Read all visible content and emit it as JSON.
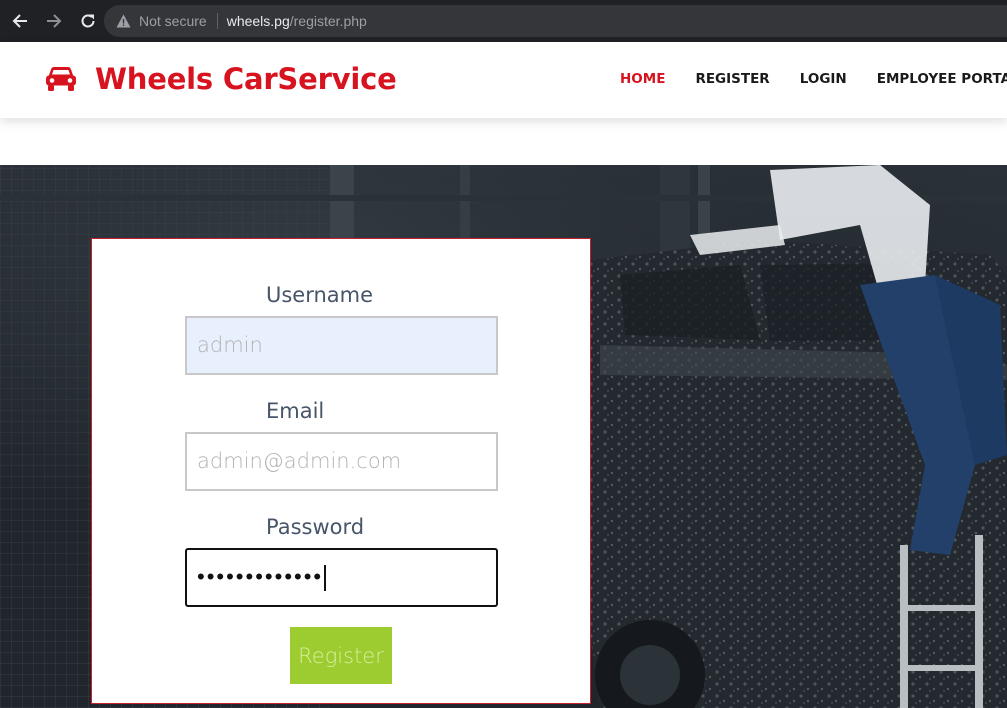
{
  "browser": {
    "security_label": "Not secure",
    "url_host": "wheels.pg",
    "url_path": "/register.php"
  },
  "header": {
    "brand": "Wheels CarService",
    "nav": [
      {
        "label": "HOME",
        "active": true
      },
      {
        "label": "REGISTER",
        "active": false
      },
      {
        "label": "LOGIN",
        "active": false
      },
      {
        "label": "EMPLOYEE PORTAL",
        "active": false
      }
    ]
  },
  "form": {
    "username_label": "Username",
    "username_value": "admin",
    "email_label": "Email",
    "email_value": "admin@admin.com",
    "password_label": "Password",
    "password_masked": "•••••••••••••",
    "submit_label": "Register"
  },
  "colors": {
    "brand_red": "#d7131f",
    "button_green": "#9ccc2f",
    "autofill_blue": "#e8f0fe"
  },
  "icons": {
    "back": "arrow-left-icon",
    "forward": "arrow-right-icon",
    "reload": "reload-icon",
    "warning": "warning-triangle-icon",
    "brand": "car-icon"
  }
}
